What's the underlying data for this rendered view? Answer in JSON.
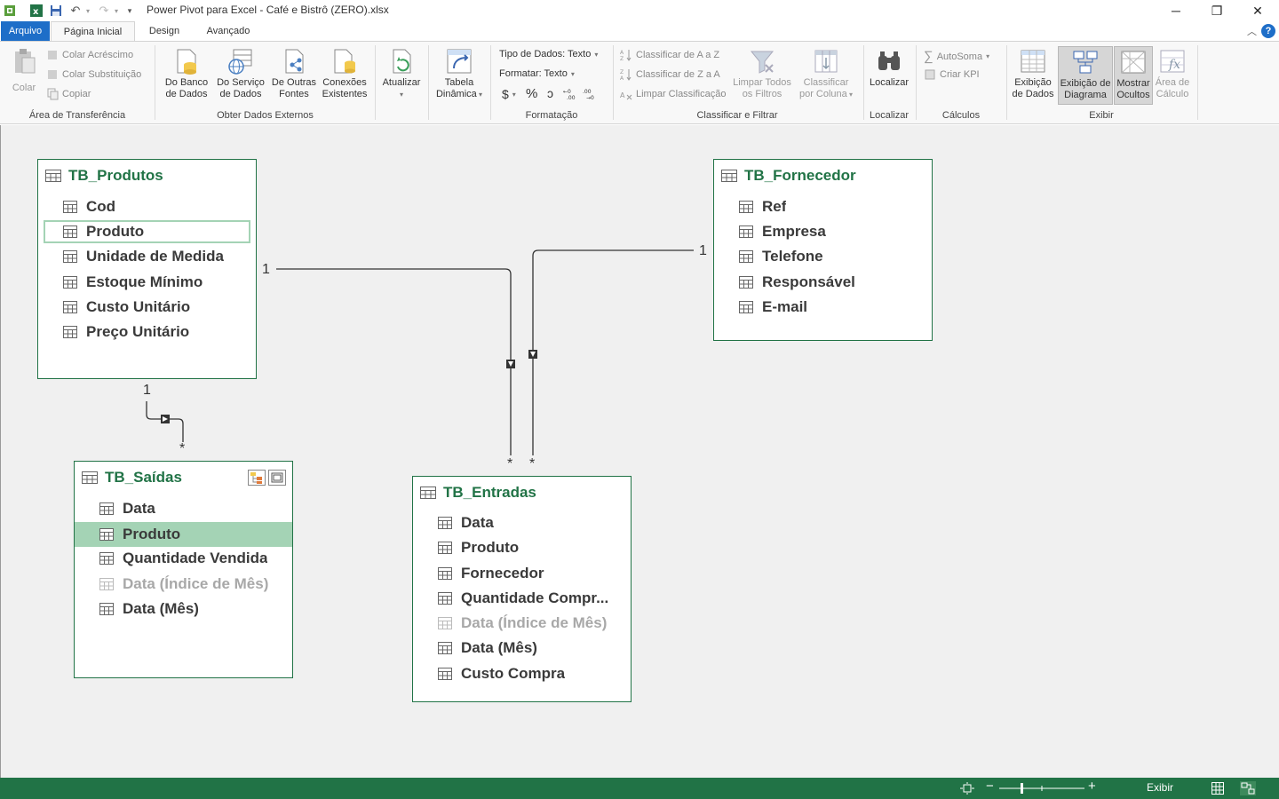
{
  "window": {
    "title": "Power Pivot para Excel - Café e Bistrô (ZERO).xlsx",
    "minimize_glyph": "─",
    "maximize_glyph": "❐",
    "close_glyph": "✕"
  },
  "tabs": {
    "arquivo": "Arquivo",
    "pagina_inicial": "Página Inicial",
    "design": "Design",
    "avancado": "Avançado"
  },
  "ribbon": {
    "clipboard": {
      "label": "Área de Transferência",
      "colar": "Colar",
      "colar_acrescimo": "Colar Acréscimo",
      "colar_substituicao": "Colar Substituição",
      "copiar": "Copiar"
    },
    "external": {
      "label": "Obter Dados Externos",
      "banco_1": "Do Banco",
      "banco_2": "de Dados",
      "servico_1": "Do Serviço",
      "servico_2": "de Dados",
      "outras_1": "De Outras",
      "outras_2": "Fontes",
      "conexoes_1": "Conexões",
      "conexoes_2": "Existentes"
    },
    "atualizar": "Atualizar",
    "tabela_1": "Tabela",
    "tabela_2": "Dinâmica",
    "formatacao": {
      "label": "Formatação",
      "tipo": "Tipo de Dados: Texto",
      "formatar": "Formatar: Texto",
      "currency": "$",
      "percent": "%",
      "comma": "ɔ"
    },
    "sort": {
      "label": "Classificar e Filtrar",
      "az": "Classificar de A a Z",
      "za": "Classificar de Z a A",
      "limpar_class": "Limpar Classificação",
      "limpar_filtros_1": "Limpar Todos",
      "limpar_filtros_2": "os Filtros",
      "por_coluna_1": "Classificar",
      "por_coluna_2": "por Coluna"
    },
    "localizar": {
      "label": "Localizar",
      "button": "Localizar"
    },
    "calculos": {
      "label": "Cálculos",
      "autosoma": "AutoSoma",
      "kpi": "Criar KPI"
    },
    "exibir": {
      "label": "Exibir",
      "dados_1": "Exibição",
      "dados_2": "de Dados",
      "diagrama_1": "Exibição de",
      "diagrama_2": "Diagrama",
      "ocultos_1": "Mostrar",
      "ocultos_2": "Ocultos",
      "calculo_1": "Área de",
      "calculo_2": "Cálculo"
    }
  },
  "diagram": {
    "tables": [
      {
        "name": "TB_Produtos",
        "fields": [
          "Cod",
          "Produto",
          "Unidade de Medida",
          "Estoque Mínimo",
          "Custo Unitário",
          "Preço Unitário"
        ]
      },
      {
        "name": "TB_Fornecedor",
        "fields": [
          "Ref",
          "Empresa",
          "Telefone",
          "Responsável",
          "E-mail"
        ]
      },
      {
        "name": "TB_Saídas",
        "fields": [
          "Data",
          "Produto",
          "Quantidade Vendida",
          "Data (Índice de Mês)",
          "Data (Mês)"
        ]
      },
      {
        "name": "TB_Entradas",
        "fields": [
          "Data",
          "Produto",
          "Fornecedor",
          "Quantidade Compr...",
          "Data (Índice de Mês)",
          "Data (Mês)",
          "Custo Compra"
        ]
      }
    ],
    "relationships": {
      "one": "1",
      "many": "*"
    }
  },
  "statusbar": {
    "exibir": "Exibir"
  },
  "colors": {
    "accent_green": "#217346",
    "selected_field": "#a4d3b5",
    "file_tab_blue": "#1e6ec8"
  }
}
